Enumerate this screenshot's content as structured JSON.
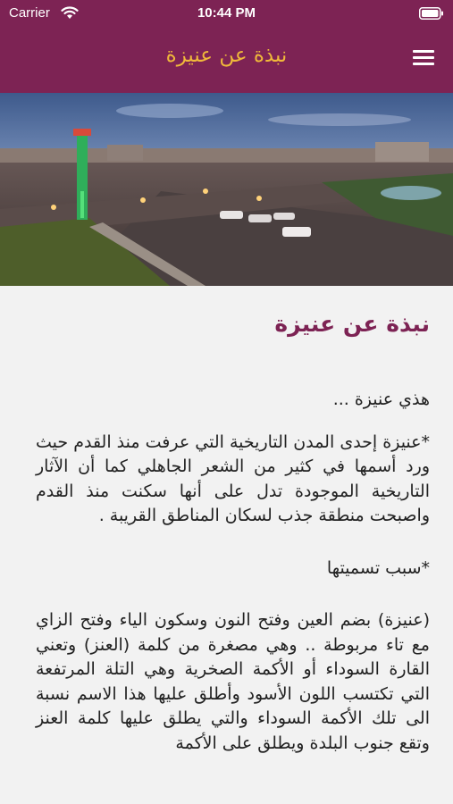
{
  "status_bar": {
    "carrier": "Carrier",
    "time": "10:44 PM"
  },
  "nav": {
    "title": "نبذة عن عنيزة",
    "menu_icon": "hamburger-menu-icon"
  },
  "hero_image": {
    "description_icon": "city-night-photo"
  },
  "article": {
    "heading": "نبذة عن عنيزة",
    "paragraphs": [
      "هذي عنيزة ...",
      "*عنيزة إحدى المدن التاريخية التي عرفت منذ القدم حيث ورد أسمها في كثير من الشعر الجاهلي كما أن الآثار التاريخية الموجودة تدل على أنها سكنت منذ القدم واصبحت منطقة جذب لسكان المناطق القريبة .",
      "*سبب تسميتها",
      "(عنيزة) بضم العين وفتح النون وسكون الياء وفتح الزاي مع تاء مربوطة .. وهي مصغرة من كلمة (العنز) وتعني القارة السوداء أو الأكمة الصخرية وهي التلة المرتفعة التي تكتسب اللون الأسود وأطلق عليها هذا الاسم نسبة الى تلك الأكمة السوداء والتي يطلق عليها كلمة العنز وتقع جنوب البلدة ويطلق على الأكمة"
    ]
  },
  "colors": {
    "header_bg": "#7d2354",
    "title_accent": "#f0b93a",
    "content_bg": "#f2f2f2"
  }
}
